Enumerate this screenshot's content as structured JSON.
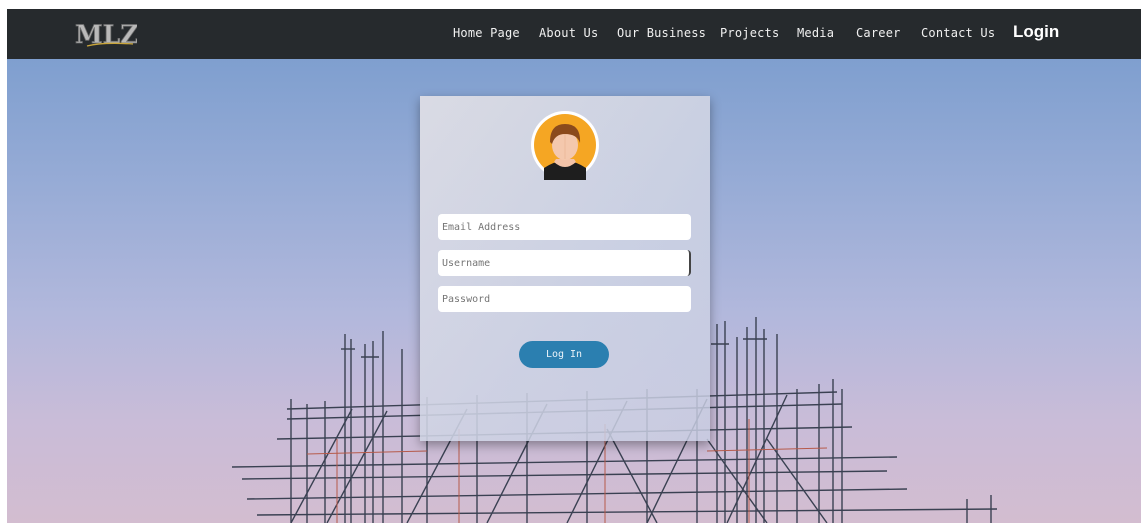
{
  "header": {
    "logo_icon": "mlz-logo-icon",
    "nav": [
      {
        "label": "Home Page"
      },
      {
        "label": "About Us"
      },
      {
        "label": "Our Business"
      },
      {
        "label": "Projects"
      },
      {
        "label": "Media"
      },
      {
        "label": "Career"
      },
      {
        "label": "Contact Us"
      }
    ],
    "login_label": "Login"
  },
  "login_form": {
    "avatar_icon": "user-avatar-icon",
    "email": {
      "placeholder": "Email Address",
      "value": ""
    },
    "username": {
      "placeholder": "Username",
      "value": ""
    },
    "password": {
      "placeholder": "Password",
      "value": ""
    },
    "submit_label": "Log In"
  },
  "background": {
    "image": "scaffolding-against-sunset-sky"
  },
  "colors": {
    "navbar": "#262a2d",
    "button": "#2b7fb0",
    "avatar_bg": "#f5a623"
  }
}
